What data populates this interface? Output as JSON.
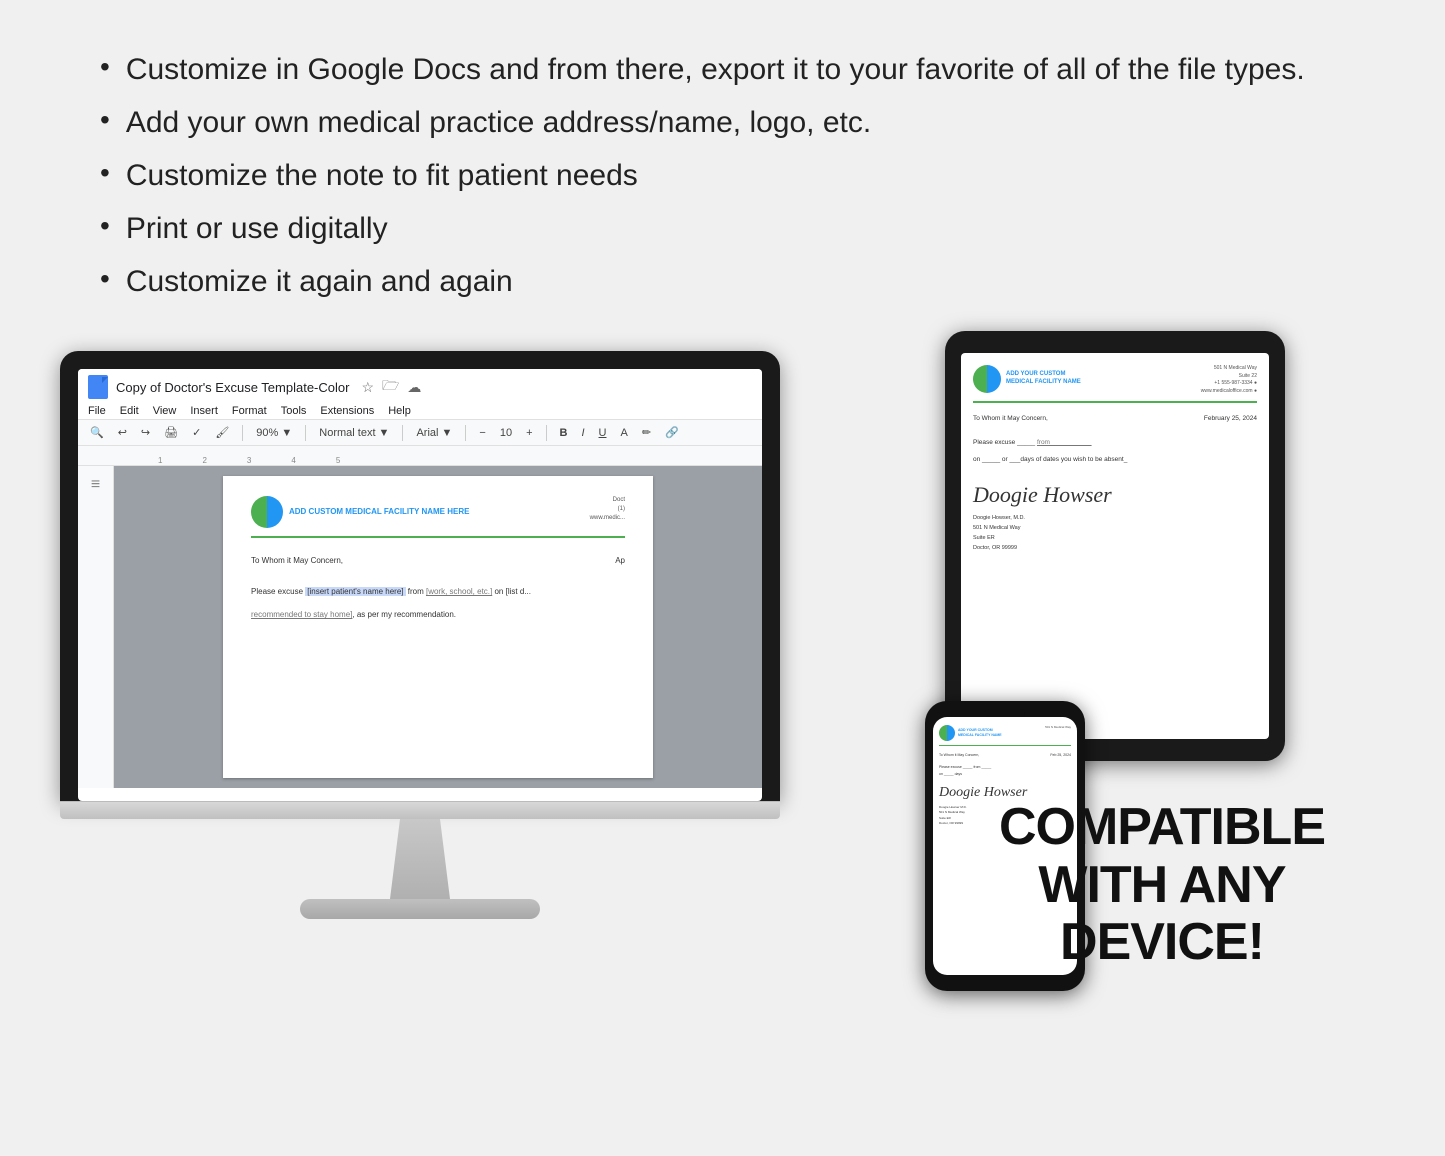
{
  "background_color": "#f0f0f0",
  "bullets": {
    "items": [
      "Customize in Google Docs and from there, export it to your favorite of all of the file types.",
      "Add your own medical practice address/name, logo, etc.",
      "Customize the note to fit patient needs",
      "Print or use digitally",
      "Customize it again and again"
    ]
  },
  "gdocs": {
    "title": "Copy of Doctor's Excuse Template-Color",
    "menu_items": [
      "File",
      "Edit",
      "View",
      "Insert",
      "Format",
      "Tools",
      "Extensions",
      "Help"
    ],
    "zoom": "90%",
    "style": "Normal text",
    "font": "Arial",
    "font_size": "10",
    "practice_name": "ADD CUSTOM MEDICAL FACILITY NAME HERE",
    "address_right": "Doct\n(1)\nwww.medic...",
    "to_whom": "To Whom it May Concern,",
    "date": "Ap",
    "excuse_text": "Please excuse",
    "patient_placeholder": "[insert patient's name here]",
    "from_text": "from",
    "from_placeholder": "[work, school, etc.]",
    "on_text": "on [list d...",
    "recommended_text": "recommended to stay home], as per my recommendation."
  },
  "tablet": {
    "practice_name": "ADD YOUR CUSTOM\nMEDICAL FACILITY NAME",
    "address": "501 N Medical Way\nSuite 22\n+1 555-987-3334 ●\nwww.medicaloffice.com ●",
    "to_whom": "To Whom it May Concern,",
    "date": "February 25, 2024",
    "excuse_label": "Please excuse",
    "from_label": "from",
    "on_label": "on _____ or ___days of dates you wish to be absent_",
    "signature": "Doogie Howser",
    "doctor_name": "Doogie Howser, M.D.",
    "doctor_address": "501 N Medical Way\nSuite ER\nDoctor, OR 99999"
  },
  "phone": {
    "practice_name": "ADD YOUR CUSTOM\nMEDICAL FACILITY NAME",
    "address": "501 N Medical Way",
    "to_whom": "To Whom it May Concern,",
    "date": "February 25, 2024",
    "signature": "Doogie Howser",
    "doctor_info": "Doogie Howser M.D.\n501 N Medical Way\nSuite ER\nDoctor, OR 99999"
  },
  "compatible": {
    "line1": "COMPATIBLE",
    "line2": "WITH ANY",
    "line3": "DEVICE!"
  }
}
